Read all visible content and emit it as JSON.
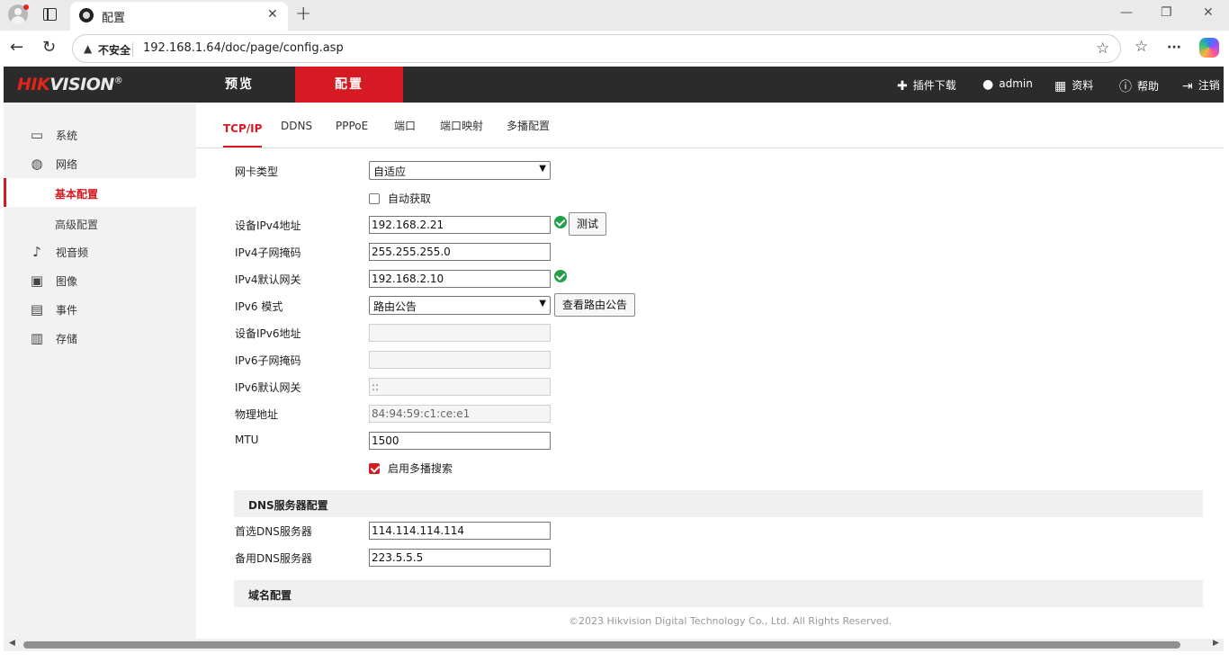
{
  "browser": {
    "tab_title": "配置",
    "tab_close": "✕",
    "new_tab": "+",
    "insecure_label": "不安全",
    "url": "192.168.1.64/doc/page/config.asp",
    "win_min": "—",
    "win_max": "❐",
    "win_close": "✕",
    "back": "←",
    "reload": "↻",
    "star": "☆",
    "favorites": "☆",
    "more": "···"
  },
  "header": {
    "logo_first": "HIK",
    "logo_rest": "VISION",
    "logo_reg": "®",
    "nav": [
      "预览",
      "配置"
    ],
    "links": {
      "plugin": "插件下载",
      "user": "admin",
      "info": "资料",
      "help": "帮助",
      "logout": "注销"
    }
  },
  "sidebar": {
    "system": "系统",
    "network": "网络",
    "basic": "基本配置",
    "advanced": "高级配置",
    "video_audio": "视音频",
    "image": "图像",
    "event": "事件",
    "storage": "存储"
  },
  "tabs": [
    "TCP/IP",
    "DDNS",
    "PPPoE",
    "端口",
    "端口映射",
    "多播配置"
  ],
  "form": {
    "nic_type_label": "网卡类型",
    "nic_type_value": "自适应",
    "dhcp_label": "自动获取",
    "ipv4_addr_label": "设备IPv4地址",
    "ipv4_addr_value": "192.168.2.21",
    "test_button": "测试",
    "ipv4_mask_label": "IPv4子网掩码",
    "ipv4_mask_value": "255.255.255.0",
    "ipv4_gw_label": "IPv4默认网关",
    "ipv4_gw_value": "192.168.2.10",
    "ipv6_mode_label": "IPv6 模式",
    "ipv6_mode_value": "路由公告",
    "view_route_button": "查看路由公告",
    "ipv6_addr_label": "设备IPv6地址",
    "ipv6_mask_label": "IPv6子网掩码",
    "ipv6_gw_label": "IPv6默认网关",
    "ipv6_gw_value": "::",
    "mac_label": "物理地址",
    "mac_value": "84:94:59:c1:ce:e1",
    "mtu_label": "MTU",
    "mtu_value": "1500",
    "multicast_label": "启用多播搜索"
  },
  "dns": {
    "section_title": "DNS服务器配置",
    "pref_label": "首选DNS服务器",
    "pref_value": "114.114.114.114",
    "alt_label": "备用DNS服务器",
    "alt_value": "223.5.5.5"
  },
  "domain": {
    "section_title": "域名配置"
  },
  "footer": "©2023 Hikvision Digital Technology Co., Ltd. All Rights Reserved.",
  "colors": {
    "brand_red": "#d51a23",
    "header_bg": "#2b2b2b",
    "ok_green": "#21a047"
  }
}
